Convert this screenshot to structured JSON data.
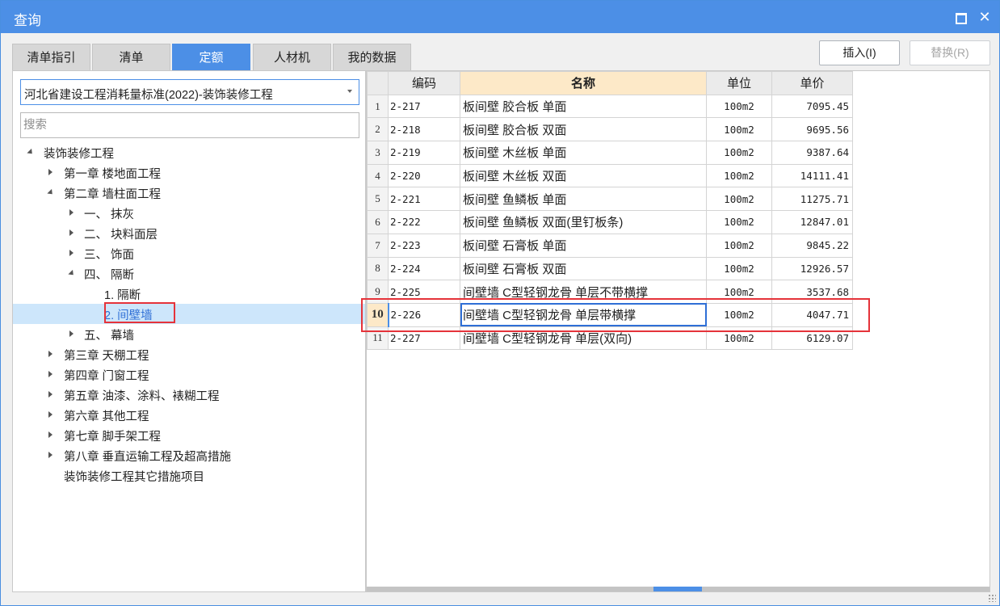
{
  "window": {
    "title": "查询"
  },
  "tabs": [
    {
      "label": "清单指引",
      "active": false
    },
    {
      "label": "清单",
      "active": false
    },
    {
      "label": "定额",
      "active": true
    },
    {
      "label": "人材机",
      "active": false
    },
    {
      "label": "我的数据",
      "active": false
    }
  ],
  "buttons": {
    "insert": "插入(I)",
    "replace": "替换(R)"
  },
  "left": {
    "library_select": "河北省建设工程消耗量标准(2022)-装饰装修工程",
    "search_placeholder": "搜索",
    "tree": [
      {
        "label": "装饰装修工程",
        "level": 0,
        "toggle": "open"
      },
      {
        "label": "第一章 楼地面工程",
        "level": 1,
        "toggle": "closed"
      },
      {
        "label": "第二章 墙柱面工程",
        "level": 1,
        "toggle": "open"
      },
      {
        "label": "一、 抹灰",
        "level": 2,
        "toggle": "closed"
      },
      {
        "label": "二、 块料面层",
        "level": 2,
        "toggle": "closed"
      },
      {
        "label": "三、 饰面",
        "level": 2,
        "toggle": "closed"
      },
      {
        "label": "四、 隔断",
        "level": 2,
        "toggle": "open"
      },
      {
        "label": "1. 隔断",
        "level": 3,
        "toggle": "none"
      },
      {
        "label": "2. 间壁墙",
        "level": 3,
        "toggle": "none",
        "selected": true
      },
      {
        "label": "五、 幕墙",
        "level": 2,
        "toggle": "closed"
      },
      {
        "label": "第三章 天棚工程",
        "level": 1,
        "toggle": "closed"
      },
      {
        "label": "第四章 门窗工程",
        "level": 1,
        "toggle": "closed"
      },
      {
        "label": "第五章 油漆、涂料、裱糊工程",
        "level": 1,
        "toggle": "closed"
      },
      {
        "label": "第六章 其他工程",
        "level": 1,
        "toggle": "closed"
      },
      {
        "label": "第七章 脚手架工程",
        "level": 1,
        "toggle": "closed"
      },
      {
        "label": "第八章 垂直运输工程及超高措施",
        "level": 1,
        "toggle": "closed"
      },
      {
        "label": "装饰装修工程其它措施项目",
        "level": 1,
        "toggle": "none"
      }
    ]
  },
  "table": {
    "columns": [
      "",
      "编码",
      "名称",
      "单位",
      "单价"
    ],
    "rows": [
      {
        "idx": "1",
        "code": "2-217",
        "name": "板间壁 胶合板 单面",
        "unit": "100m2",
        "price": "7095.45"
      },
      {
        "idx": "2",
        "code": "2-218",
        "name": "板间壁 胶合板 双面",
        "unit": "100m2",
        "price": "9695.56"
      },
      {
        "idx": "3",
        "code": "2-219",
        "name": "板间壁 木丝板 单面",
        "unit": "100m2",
        "price": "9387.64"
      },
      {
        "idx": "4",
        "code": "2-220",
        "name": "板间壁 木丝板 双面",
        "unit": "100m2",
        "price": "14111.41"
      },
      {
        "idx": "5",
        "code": "2-221",
        "name": "板间壁 鱼鳞板 单面",
        "unit": "100m2",
        "price": "11275.71"
      },
      {
        "idx": "6",
        "code": "2-222",
        "name": "板间壁 鱼鳞板 双面(里钉板条)",
        "unit": "100m2",
        "price": "12847.01"
      },
      {
        "idx": "7",
        "code": "2-223",
        "name": "板间壁 石膏板 单面",
        "unit": "100m2",
        "price": "9845.22"
      },
      {
        "idx": "8",
        "code": "2-224",
        "name": "板间壁 石膏板 双面",
        "unit": "100m2",
        "price": "12926.57"
      },
      {
        "idx": "9",
        "code": "2-225",
        "name": "间壁墙 C型轻钢龙骨 单层不带横撑",
        "unit": "100m2",
        "price": "3537.68"
      },
      {
        "idx": "10",
        "code": "2-226",
        "name": "间壁墙 C型轻钢龙骨 单层带横撑",
        "unit": "100m2",
        "price": "4047.71",
        "selected": true
      },
      {
        "idx": "11",
        "code": "2-227",
        "name": "间壁墙 C型轻钢龙骨 单层(双向)",
        "unit": "100m2",
        "price": "6129.07"
      }
    ]
  },
  "colors": {
    "accent": "#4c8fe6",
    "highlight": "#e5333a",
    "header_name_bg": "#fde9c8"
  }
}
